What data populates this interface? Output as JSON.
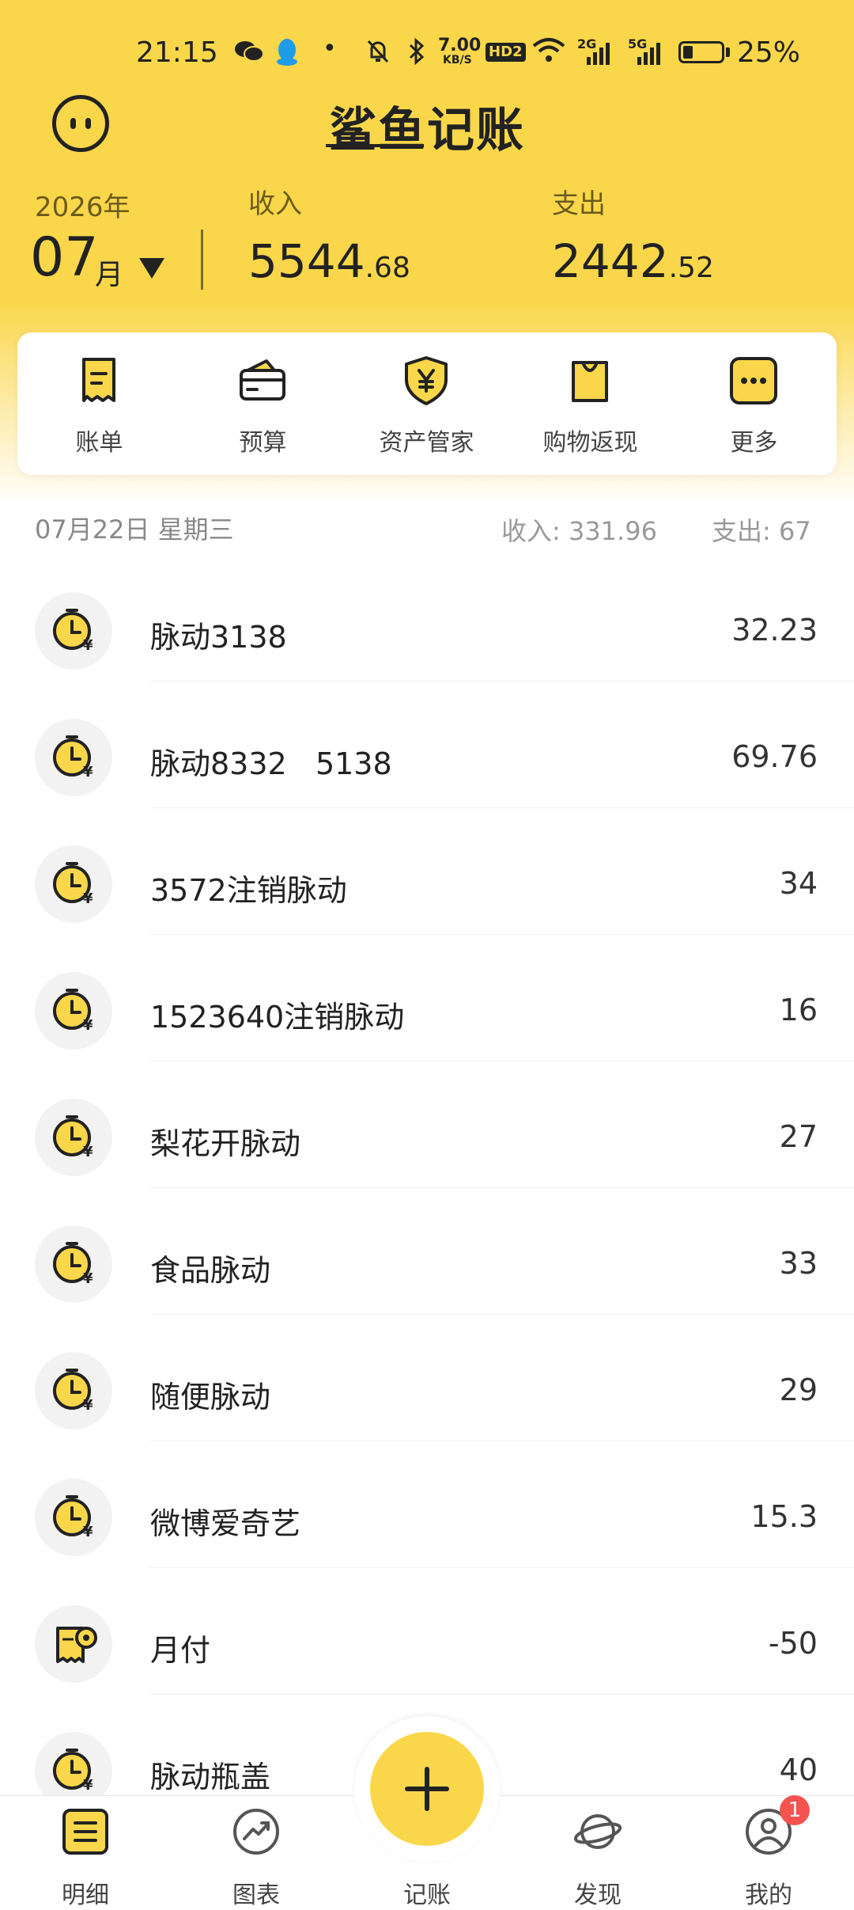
{
  "status_bar": {
    "time": "21:15",
    "net_speed": "7.00",
    "net_unit": "KB/S",
    "hd": "HD2",
    "sig1": "2G",
    "sig2": "5G",
    "battery_pct": "25%",
    "battery_level": 0.25
  },
  "header": {
    "app_title": "鲨鱼记账",
    "year": "2026年",
    "month": "07",
    "month_unit": "月",
    "income_label": "收入",
    "income_int": "5544",
    "income_dec": ".68",
    "expense_label": "支出",
    "expense_int": "2442",
    "expense_dec": ".52"
  },
  "quick_actions": [
    {
      "label": "账单",
      "icon": "bill-icon"
    },
    {
      "label": "预算",
      "icon": "wallet-icon"
    },
    {
      "label": "资产管家",
      "icon": "shield-yen-icon"
    },
    {
      "label": "购物返现",
      "icon": "shopping-bag-icon"
    },
    {
      "label": "更多",
      "icon": "more-icon"
    }
  ],
  "day": {
    "date": "07月22日 星期三",
    "income": "收入: 331.96",
    "expense": "支出: 67"
  },
  "transactions": [
    {
      "name": "脉动3138",
      "amount": "32.23",
      "icon": "clock-yen-icon"
    },
    {
      "name": "脉动8332   5138",
      "amount": "69.76",
      "icon": "clock-yen-icon"
    },
    {
      "name": "3572注销脉动",
      "amount": "34",
      "icon": "clock-yen-icon"
    },
    {
      "name": "1523640注销脉动",
      "amount": "16",
      "icon": "clock-yen-icon"
    },
    {
      "name": "梨花开脉动",
      "amount": "27",
      "icon": "clock-yen-icon"
    },
    {
      "name": "食品脉动",
      "amount": "33",
      "icon": "clock-yen-icon"
    },
    {
      "name": "随便脉动",
      "amount": "29",
      "icon": "clock-yen-icon"
    },
    {
      "name": "微博爱奇艺",
      "amount": "15.3",
      "icon": "clock-yen-icon"
    },
    {
      "name": "月付",
      "amount": "-50",
      "icon": "receipt-icon"
    },
    {
      "name": "脉动瓶盖",
      "amount": "40",
      "icon": "clock-yen-icon"
    }
  ],
  "bottom_nav": [
    {
      "label": "明细",
      "icon": "list-icon"
    },
    {
      "label": "图表",
      "icon": "chart-icon"
    },
    {
      "label": "记账",
      "icon": "plus-icon"
    },
    {
      "label": "发现",
      "icon": "planet-icon"
    },
    {
      "label": "我的",
      "icon": "user-icon"
    }
  ],
  "badge_count": "1",
  "colors": {
    "accent": "#FAD74A",
    "text": "#222222",
    "badge": "#F4534F"
  }
}
